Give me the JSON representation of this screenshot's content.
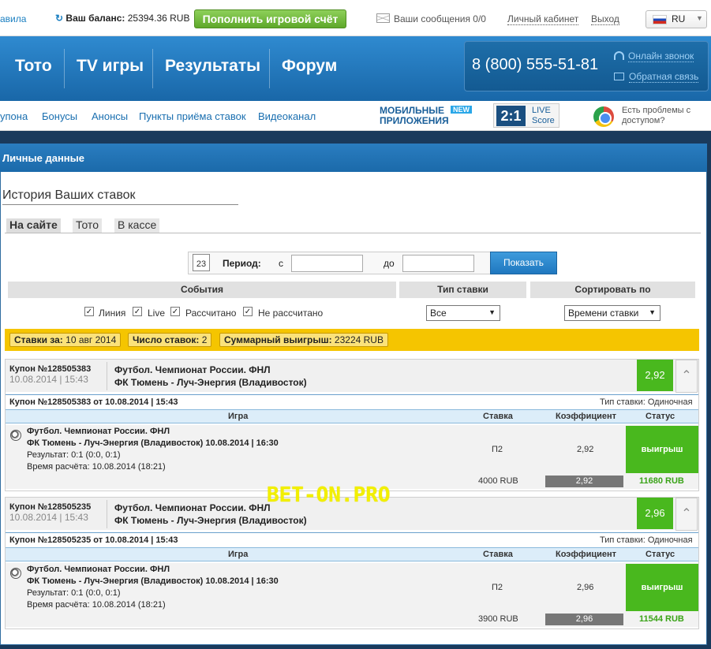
{
  "topbar": {
    "rules_fragment": "авила",
    "balance_label": "Ваш баланс:",
    "balance_value": "25394.36 RUB",
    "topup_button": "Пополнить игровой счёт",
    "messages": "Ваши сообщения 0/0",
    "cabinet": "Личный кабинет",
    "exit": "Выход",
    "lang": "RU"
  },
  "nav": {
    "items": [
      "Тото",
      "TV игры",
      "Результаты",
      "Форум"
    ],
    "phone": "8 (800) 555-51-81",
    "online_call": "Онлайн звонок",
    "feedback": "Обратная связь"
  },
  "subnav": {
    "items": [
      "упона",
      "Бонусы",
      "Анонсы",
      "Пункты приёма ставок",
      "Видеоканал"
    ],
    "mobile_line1": "МОБИЛЬНЫЕ",
    "mobile_line2": "ПРИЛОЖЕНИЯ",
    "new_badge": "NEW",
    "live_score_box": "2:1",
    "live_line1": "LIVE",
    "live_line2": "Score",
    "problems_line1": "Есть проблемы с",
    "problems_line2": "доступом?"
  },
  "page": {
    "header": "Личные данные",
    "history_title": "История Ваших ставок",
    "tabs": [
      "На сайте",
      "Тото",
      "В кассе"
    ],
    "period_label": "Период:",
    "from_label": "с",
    "to_label": "до",
    "calendar_day": "23",
    "show_button": "Показать",
    "col_events": "События",
    "col_bet_type": "Тип ставки",
    "col_sort": "Сортировать по",
    "filters": [
      "Линия",
      "Live",
      "Рассчитано",
      "Не рассчитано"
    ],
    "bet_type_value": "Все",
    "sort_value": "Времени ставки",
    "summary": {
      "bets_for_label": "Ставки за:",
      "bets_for_value": "10 авг 2014",
      "count_label": "Число ставок:",
      "count_value": "2",
      "total_label": "Суммарный выигрыш:",
      "total_value": "23224 RUB"
    }
  },
  "coupons": [
    {
      "num": "Купон №128505383",
      "datetime": "10.08.2014 | 15:43",
      "event_line1": "Футбол. Чемпионат России. ФНЛ",
      "event_line2": "ФК Тюмень - Луч-Энергия (Владивосток)",
      "odd": "2,92",
      "sub_title": "Купон №128505383 от 10.08.2014 | 15:43",
      "bet_type": "Тип ставки: Одиночная",
      "col_game": "Игра",
      "col_stake": "Ставка",
      "col_coef": "Коэффициент",
      "col_status": "Статус",
      "game_line1": "Футбол. Чемпионат России. ФНЛ",
      "game_line2": "ФК Тюмень - Луч-Энергия (Владивосток) 10.08.2014 | 16:30",
      "game_result": "Результат: 0:1 (0:0, 0:1)",
      "game_calc": "Время расчёта: 10.08.2014 (18:21)",
      "outcome": "П2",
      "coef": "2,92",
      "status": "выигрыш",
      "stake": "4000 RUB",
      "foot_coef": "2,92",
      "win": "11680 RUB"
    },
    {
      "num": "Купон №128505235",
      "datetime": "10.08.2014 | 15:43",
      "event_line1": "Футбол. Чемпионат России. ФНЛ",
      "event_line2": "ФК Тюмень - Луч-Энергия (Владивосток)",
      "odd": "2,96",
      "sub_title": "Купон №128505235 от 10.08.2014 | 15:43",
      "bet_type": "Тип ставки: Одиночная",
      "col_game": "Игра",
      "col_stake": "Ставка",
      "col_coef": "Коэффициент",
      "col_status": "Статус",
      "game_line1": "Футбол. Чемпионат России. ФНЛ",
      "game_line2": "ФК Тюмень - Луч-Энергия (Владивосток) 10.08.2014 | 16:30",
      "game_result": "Результат: 0:1 (0:0, 0:1)",
      "game_calc": "Время расчёта: 10.08.2014 (18:21)",
      "outcome": "П2",
      "coef": "2,96",
      "status": "выигрыш",
      "stake": "3900 RUB",
      "foot_coef": "2,96",
      "win": "11544 RUB"
    }
  ],
  "watermark": "BET-ON.PRO"
}
